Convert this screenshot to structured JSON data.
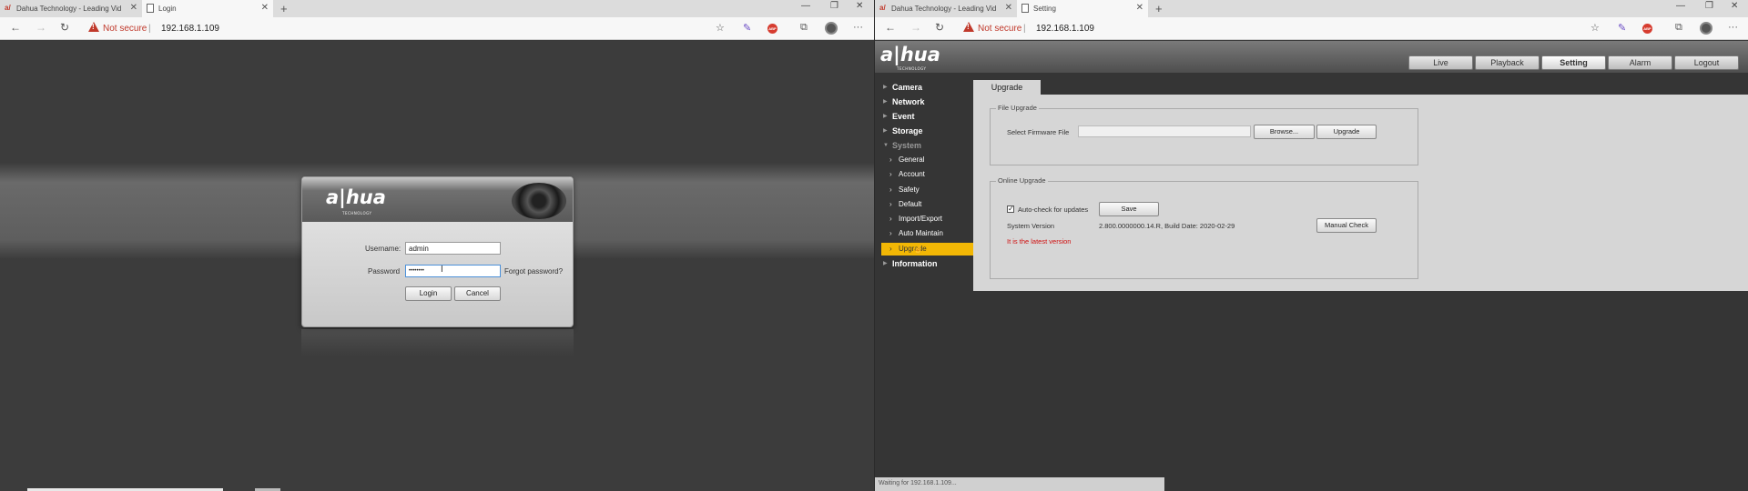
{
  "left": {
    "tabs": [
      {
        "label": "Dahua Technology - Leading Vid",
        "icon": "dahua-favicon"
      },
      {
        "label": "Login",
        "icon": "page-icon"
      }
    ],
    "address": {
      "warning": "Not secure",
      "separator": "|",
      "url": "192.168.1.109"
    },
    "login": {
      "brand": "a|hua",
      "brand_sub": "TECHNOLOGY",
      "username_label": "Username:",
      "username_value": "admin",
      "password_label": "Password",
      "password_value": "••••••••",
      "forgot": "Forgot password?",
      "login_btn": "Login",
      "cancel_btn": "Cancel"
    }
  },
  "right": {
    "tabs": [
      {
        "label": "Dahua Technology - Leading Vid",
        "icon": "dahua-favicon"
      },
      {
        "label": "Setting",
        "icon": "page-icon"
      }
    ],
    "address": {
      "warning": "Not secure",
      "separator": "|",
      "url": "192.168.1.109"
    },
    "header": {
      "brand": "a|hua",
      "brand_sub": "TECHNOLOGY",
      "tabs": [
        "Live",
        "Playback",
        "Setting",
        "Alarm",
        "Logout"
      ]
    },
    "sidebar": {
      "top": [
        "Camera",
        "Network",
        "Event",
        "Storage",
        "System"
      ],
      "system_sub": [
        "General",
        "Account",
        "Safety",
        "Default",
        "Import/Export",
        "Auto Maintain",
        "Upgrade"
      ],
      "bottom": "Information"
    },
    "content": {
      "tab": "Upgrade",
      "file_upgrade": {
        "legend": "File Upgrade",
        "label": "Select Firmware File",
        "browse_btn": "Browse...",
        "upgrade_btn": "Upgrade"
      },
      "online_upgrade": {
        "legend": "Online Upgrade",
        "auto_check_label": "Auto-check for updates",
        "save_btn": "Save",
        "version_label": "System Version",
        "version_value": "2.800.0000000.14.R, Build Date: 2020-02-29",
        "manual_btn": "Manual Check",
        "status_msg": "It is the latest version"
      }
    },
    "status_bar": "Waiting for 192.168.1.109..."
  }
}
